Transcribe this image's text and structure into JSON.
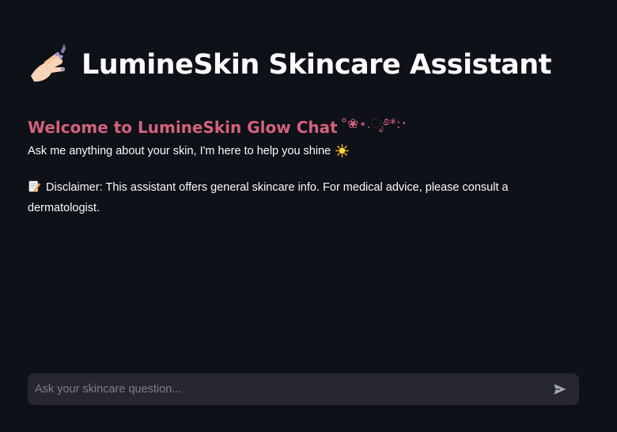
{
  "header": {
    "title": "LumineSkin Skincare Assistant",
    "title_icon": "nail-polish-icon"
  },
  "main": {
    "welcome_text": "Welcome to LumineSkin Glow Chat",
    "welcome_decoration": "°❀⋆.ೃ࿔*:･",
    "tagline": "Ask me anything about your skin, I'm here to help you shine",
    "tagline_icon": "sun-icon",
    "disclaimer_icon": "memo-icon",
    "disclaimer": "Disclaimer: This assistant offers general skincare info. For medical advice, please consult a dermatologist."
  },
  "chat": {
    "placeholder": "Ask your skincare question...",
    "send_icon": "send-icon"
  },
  "colors": {
    "background": "#0e1117",
    "accent_pink": "#d3617f",
    "input_bg": "#262730",
    "placeholder": "#7d7f87"
  }
}
